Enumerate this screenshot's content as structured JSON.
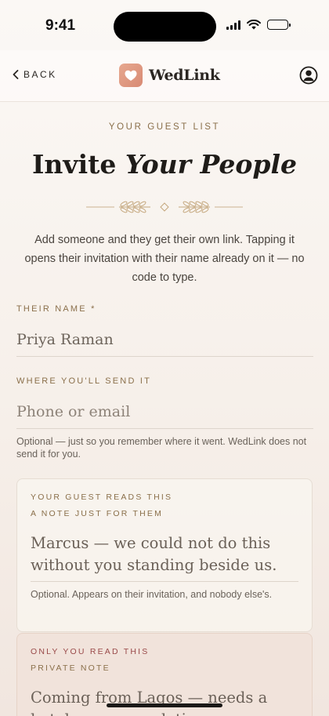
{
  "status_bar": {
    "time": "9:41"
  },
  "header": {
    "back_label": "BACK",
    "brand_name": "WedLink"
  },
  "page": {
    "eyebrow": "YOUR GUEST LIST",
    "title_plain": "Invite ",
    "title_accent": "Your People",
    "intro": "Add someone and they get their own link. Tapping it opens their invitation with their name already on it — no code to type."
  },
  "form": {
    "name_label": "THEIR NAME *",
    "name_value": "Priya Raman",
    "contact_label": "WHERE YOU'LL SEND IT",
    "contact_placeholder": "Phone or email",
    "contact_helper": "Optional — just so you remember where it went. WedLink does not send it for you."
  },
  "note_card": {
    "eyebrow": "YOUR GUEST READS THIS",
    "label": "A NOTE JUST FOR THEM",
    "text": "Marcus — we could not do this without you standing beside us.",
    "helper": "Optional. Appears on their invitation, and nobody else's."
  },
  "private_card": {
    "eyebrow": "ONLY YOU READ THIS",
    "label": "PRIVATE NOTE",
    "text": "Coming from Lagos — needs a hotel recommendation."
  },
  "colors": {
    "accent_gold": "#8a6f4a",
    "accent_rose": "#9a4a4a",
    "logo": "#e0987f"
  },
  "icons": {
    "back": "chevron-left-icon",
    "logo": "heart-icon",
    "profile": "user-circle-icon"
  }
}
